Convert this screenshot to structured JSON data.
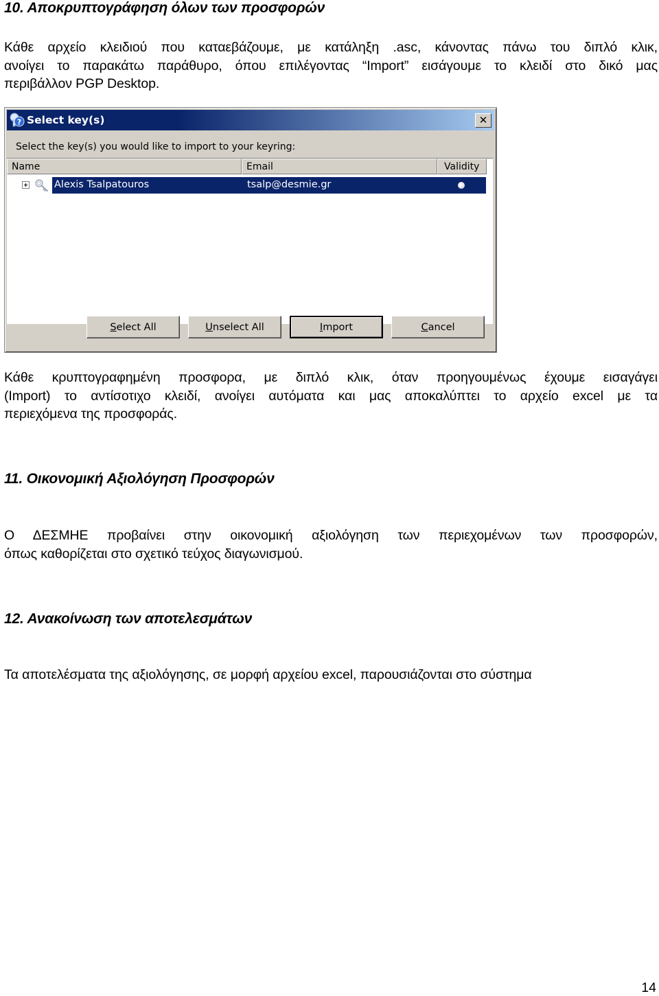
{
  "sections": [
    {
      "heading": "10. Αποκρυπτογράφηση όλων των προσφορών",
      "paragraph_lines": [
        "Κάθε αρχείο κλειδιού που καταεβάζουμε, με κατάληξη .asc, κάνοντας πάνω του διπλό κλικ,",
        "ανοίγει το παρακάτω παράθυρο, όπου επιλέγοντας “Import” εισάγουμε το κλειδί στο δικό μας",
        "περιβάλλον PGP Desktop."
      ],
      "after_dialog_lines": [
        "Κάθε κρυπτογραφημένη προσφορα, με διπλό κλικ, όταν προηγουμένως έχουμε εισαγάγει",
        "(Import) το  αντίσοτιχο κλειδί, ανοίγει αυτόματα και μας αποκαλύπτει το αρχείο excel με τα",
        "περιεχόμενα της προσφοράς."
      ]
    },
    {
      "heading": "11. Οικονομική Αξιολόγηση Προσφορών",
      "paragraph_lines": [
        "Ο ΔΕΣΜΗΕ προβαίνει στην οικονομική αξιολόγηση των περιεχομένων των  προσφορών,",
        "όπως καθορίζεται στο σχετικό τεύχος διαγωνισμού."
      ]
    },
    {
      "heading": "12. Ανακοίνωση των αποτελεσμάτων",
      "paragraph_lines": [
        "Τα αποτελέσματα της αξιολόγησης, σε μορφή αρχείου excel, παρουσιάζονται στο σύστημα"
      ]
    }
  ],
  "dialog": {
    "title": "Select key(s)",
    "title_icon": "pgp-key-help-icon",
    "close_label": "✕",
    "prompt": "Select the key(s) you would like to import to your keyring:",
    "columns": [
      "Name",
      "Email",
      "Validity"
    ],
    "rows": [
      {
        "name": "Alexis Tsalpatouros",
        "email": "tsalp@desmie.gr",
        "validity": "valid-dot",
        "selected": true,
        "expandable": true,
        "icon": "key-icon"
      }
    ],
    "buttons": {
      "select_all": {
        "mnemonic": "S",
        "rest": "elect All"
      },
      "unselect_all": {
        "mnemonic": "U",
        "rest": "nselect All"
      },
      "import": {
        "mnemonic": "I",
        "rest": "mport"
      },
      "cancel": {
        "mnemonic": "C",
        "rest": "ancel"
      }
    },
    "colors": {
      "title_bar": "#0a246a",
      "selection": "#0a246a",
      "face": "#d4d0c8"
    }
  },
  "page_number": "14"
}
